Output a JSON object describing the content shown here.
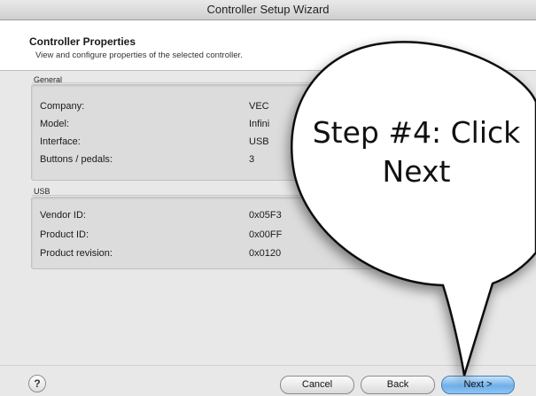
{
  "window": {
    "title": "Controller Setup Wizard"
  },
  "header": {
    "title": "Controller Properties",
    "subtitle": "View and configure properties of the selected controller."
  },
  "general": {
    "label": "General",
    "rows": [
      {
        "key": "Company:",
        "value": "VEC"
      },
      {
        "key": "Model:",
        "value": "Infini"
      },
      {
        "key": "Interface:",
        "value": "USB"
      },
      {
        "key": "Buttons / pedals:",
        "value": "3"
      }
    ]
  },
  "usb": {
    "label": "USB",
    "rows": [
      {
        "key": "Vendor ID:",
        "value": "0x05F3"
      },
      {
        "key": "Product ID:",
        "value": "0x00FF"
      },
      {
        "key": "Product revision:",
        "value": "0x0120"
      }
    ]
  },
  "footer": {
    "help_label": "?",
    "cancel_label": "Cancel",
    "back_label": "Back",
    "next_label": "Next >"
  },
  "callout": {
    "line1": "Step #4: Click",
    "line2": "Next"
  },
  "icons": {
    "help": "help-icon"
  },
  "colors": {
    "default_button": "#6fb0ea",
    "callout_fill": "#ffffff"
  }
}
